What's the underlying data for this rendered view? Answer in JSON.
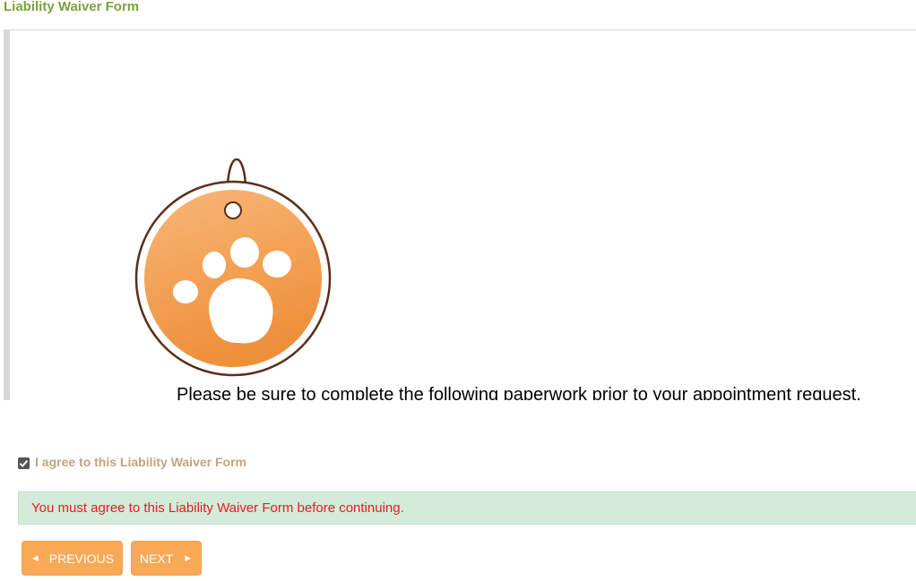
{
  "form": {
    "title": "Liability Waiver Form"
  },
  "document": {
    "instruction_text": "Please be sure to complete the following paperwork prior to your appointment request.",
    "logo": "paw-print-tag-icon"
  },
  "agreement": {
    "checked": true,
    "label": "I agree to this Liability Waiver Form"
  },
  "alert": {
    "message": "You must agree to this Liability Waiver Form before continuing."
  },
  "nav": {
    "previous_label": "PREVIOUS",
    "next_label": "NEXT",
    "previous_icon": "left-arrow-icon",
    "next_icon": "right-arrow-icon"
  },
  "colors": {
    "title": "#7aa13f",
    "button": "#f7a956",
    "alert_bg": "#d4ebd9",
    "alert_text": "#e01d24",
    "checkbox_label": "#c4a27c"
  }
}
